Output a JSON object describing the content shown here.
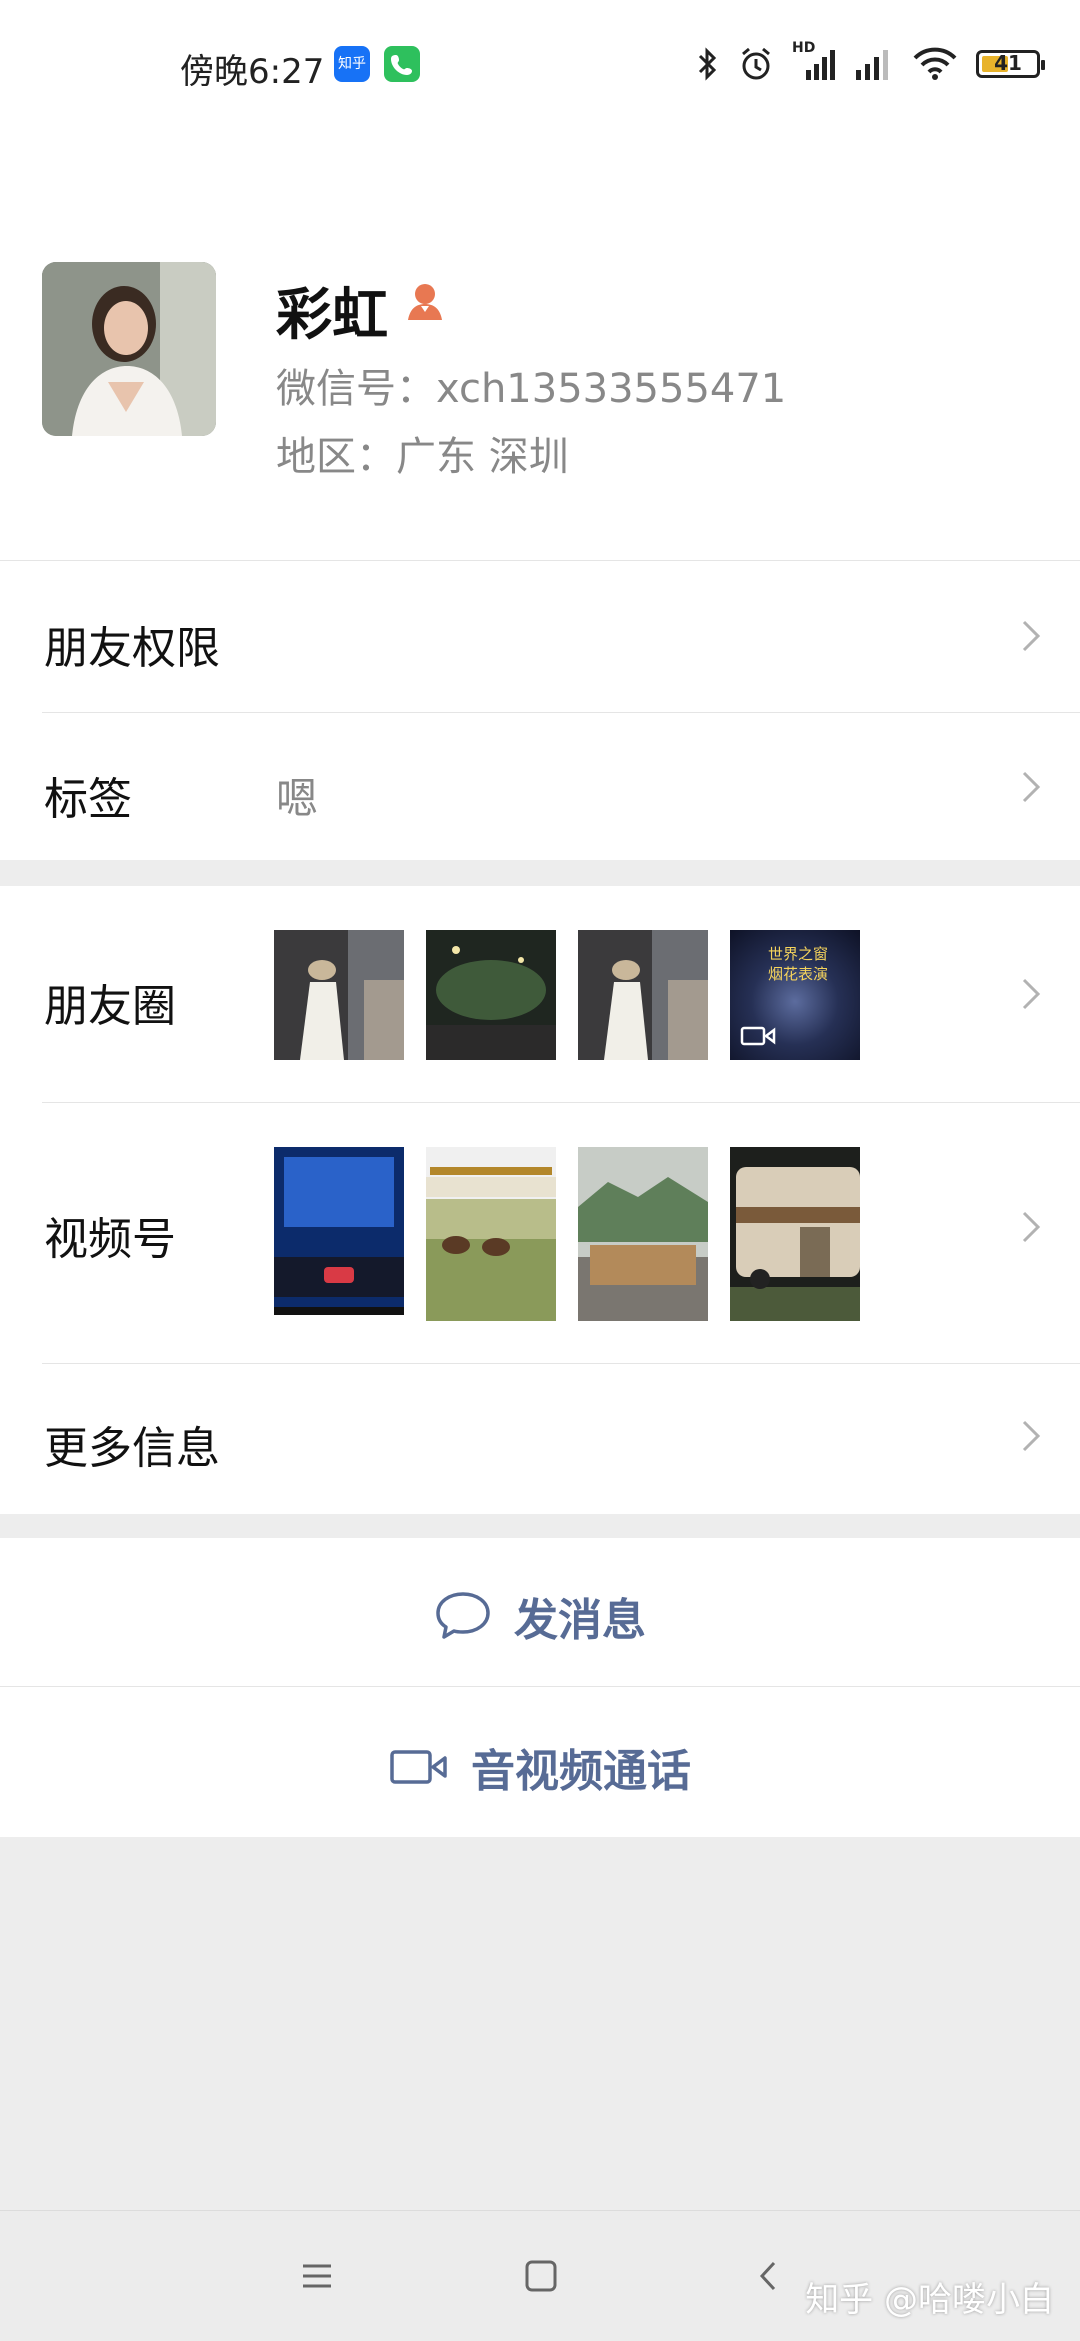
{
  "status_bar": {
    "time": "傍晚6:27",
    "app_icons": [
      "知乎",
      "phone"
    ],
    "battery": "41",
    "signal_label": "HD"
  },
  "profile": {
    "name": "彩虹",
    "wechat_id": "微信号：xch13533555471",
    "region": "地区：广东  深圳"
  },
  "rows": {
    "friend_permissions": "朋友权限",
    "tags_label": "标签",
    "tags_value": "嗯",
    "moments": "朋友圈",
    "channels": "视频号",
    "more_info": "更多信息"
  },
  "moments_thumbs": [
    {
      "name": "moments-thumb-1",
      "text": ""
    },
    {
      "name": "moments-thumb-2",
      "text": ""
    },
    {
      "name": "moments-thumb-3",
      "text": ""
    },
    {
      "name": "moments-thumb-4",
      "text": "世界之窗\n烟花表演"
    }
  ],
  "actions": {
    "send_message": "发消息",
    "video_call": "音视频通话"
  },
  "watermark": "知乎 @哈喽小白",
  "colors": {
    "link_blue": "#576b95",
    "background": "#ededed",
    "badge_orange": "#e87852"
  }
}
